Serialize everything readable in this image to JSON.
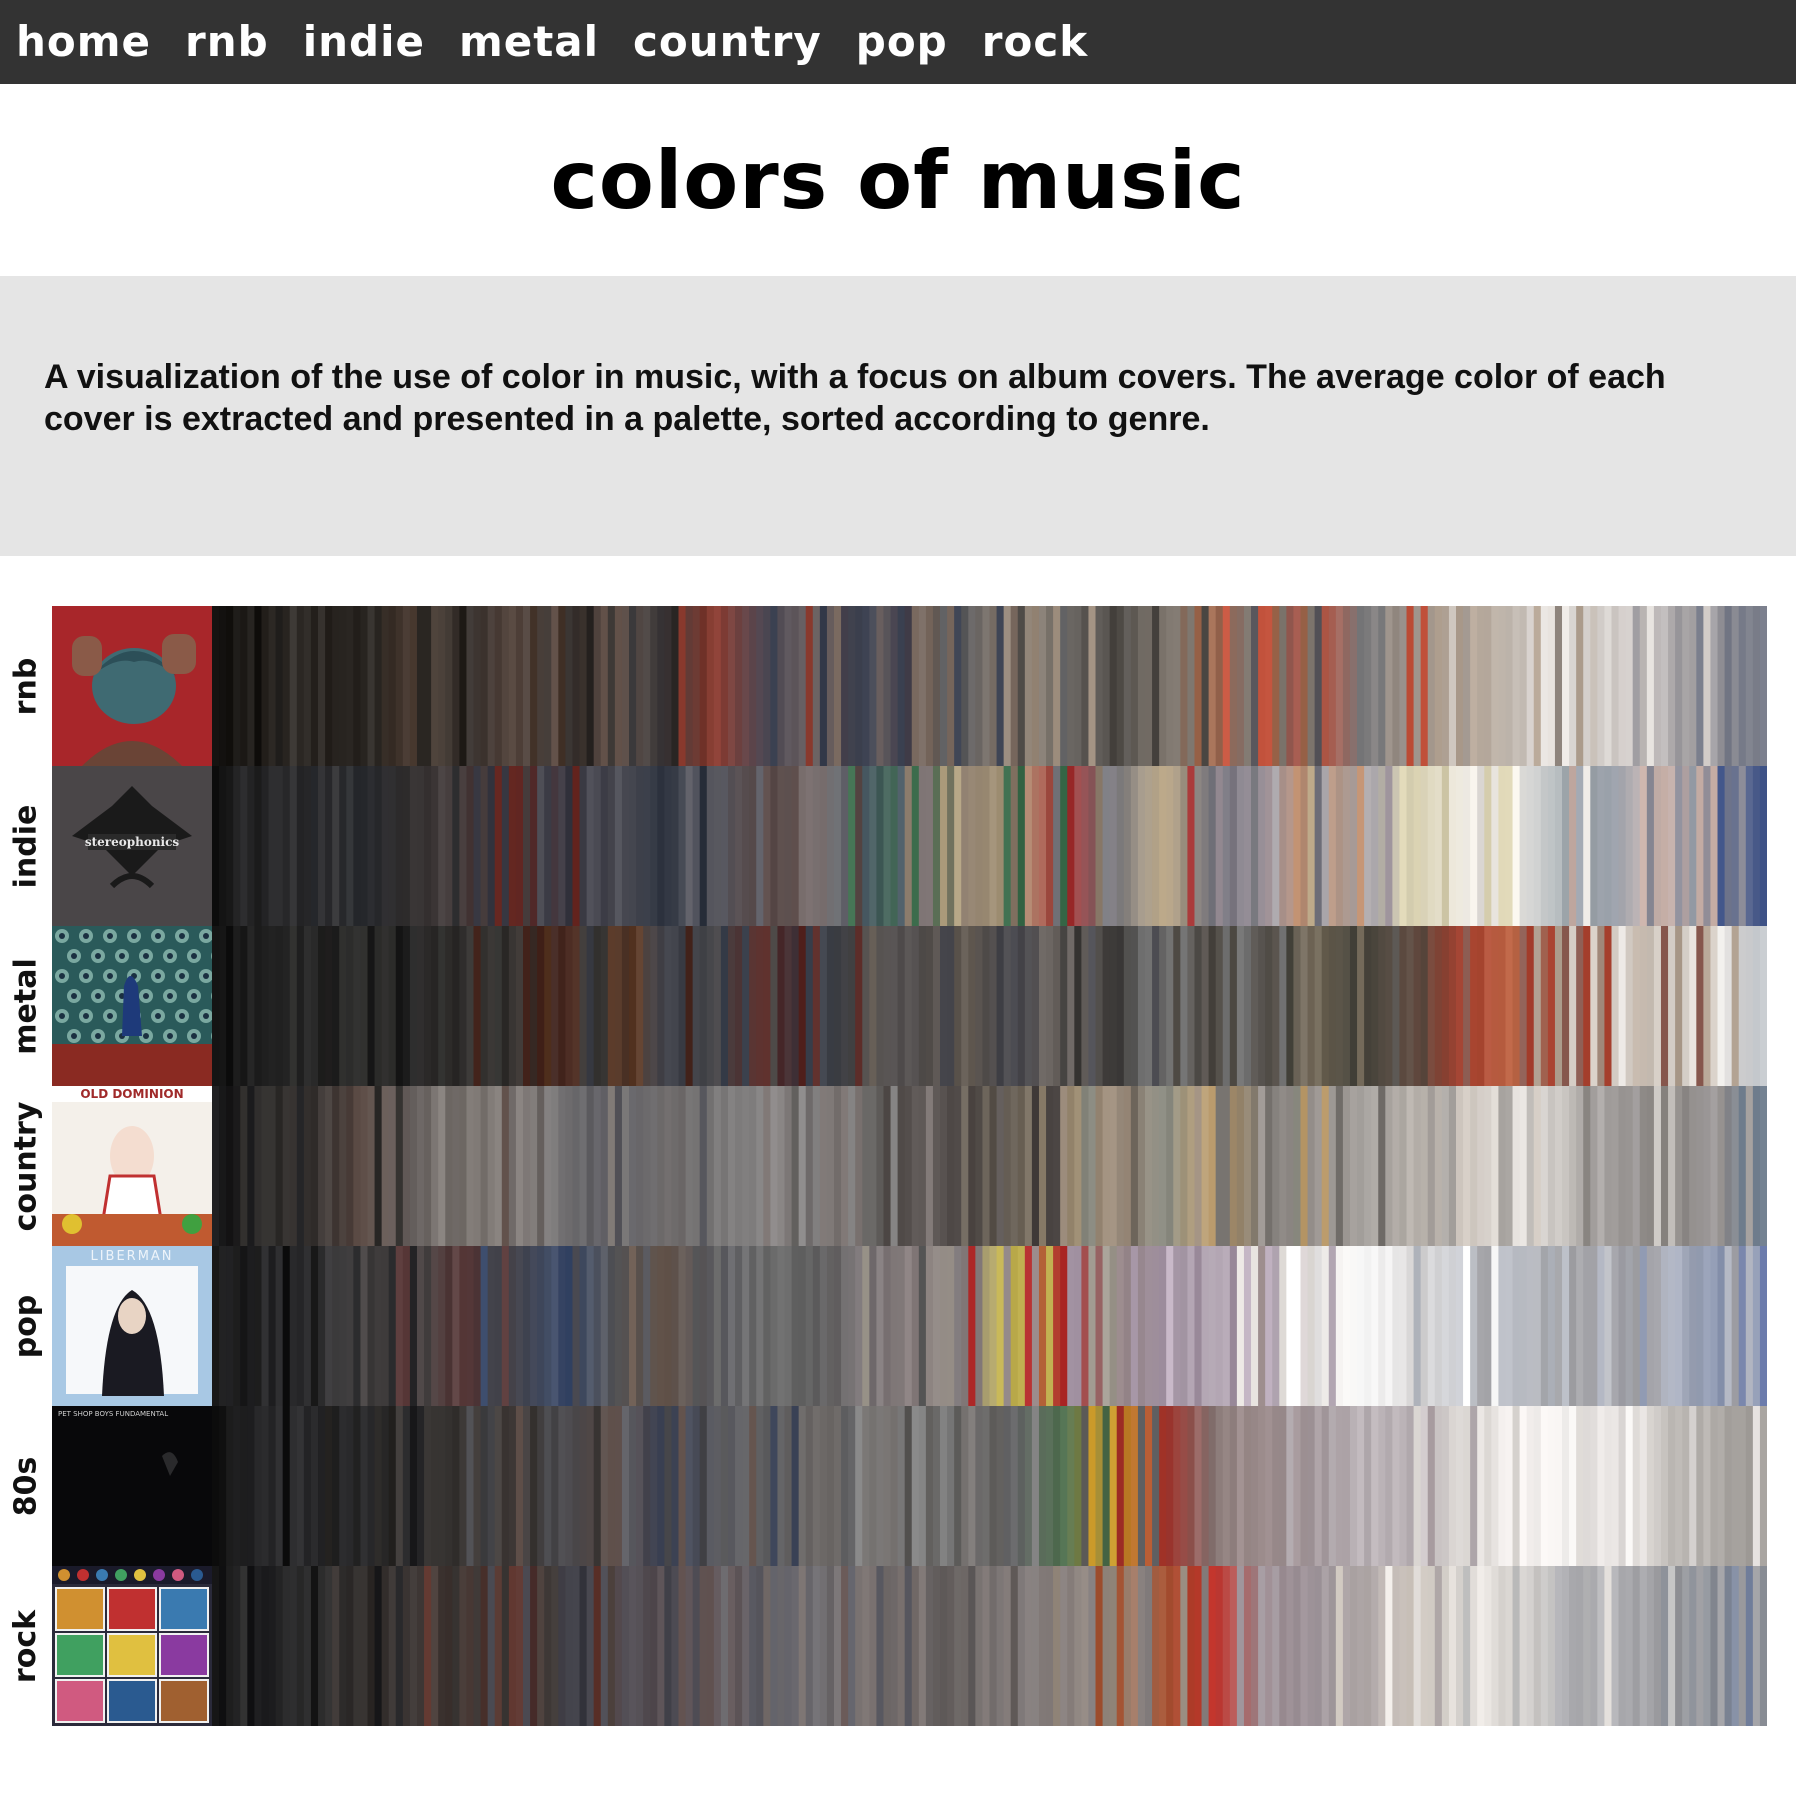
{
  "nav": {
    "items": [
      {
        "id": "home",
        "label": "home"
      },
      {
        "id": "rnb",
        "label": "rnb"
      },
      {
        "id": "indie",
        "label": "indie"
      },
      {
        "id": "metal",
        "label": "metal"
      },
      {
        "id": "country",
        "label": "country"
      },
      {
        "id": "pop",
        "label": "pop"
      },
      {
        "id": "rock",
        "label": "rock"
      }
    ]
  },
  "header": {
    "title": "colors of music"
  },
  "intro": {
    "text": "A visualization of the use of color in music, with a focus on album covers. The average color of each cover is extracted and presented in a palette, sorted according to genre."
  },
  "genres": [
    {
      "label": "rnb",
      "cover": {
        "kind": "rnb",
        "bg": "#a8262a",
        "accent": "#3f6a72",
        "skin": "#8a5a48"
      },
      "palette": [
        "#141210",
        "#2a2622",
        "#3a3632",
        "#24201c",
        "#4a3a30",
        "#3b3633",
        "#5a4a42",
        "#2e2a28",
        "#6b5a52",
        "#3c3a3c",
        "#8a3a2e",
        "#4a4652",
        "#6a6060",
        "#3a4050",
        "#7a6a60",
        "#5a5a5c",
        "#9a8a7a",
        "#6e6a66",
        "#4c4844",
        "#807870",
        "#a06a50",
        "#5c5a60",
        "#c0503a",
        "#7a7a7c",
        "#9a9088",
        "#b0a090",
        "#c8c0b8",
        "#e8e4e0",
        "#d6d0cc",
        "#b8b4b4",
        "#9c9a9e",
        "#707482"
      ]
    },
    {
      "label": "indie",
      "cover": {
        "kind": "indie",
        "bg": "#4a4648",
        "accent": "#1a1a1a",
        "text": "stereophonics"
      },
      "palette": [
        "#161616",
        "#262628",
        "#323234",
        "#2a2c30",
        "#3c3838",
        "#4a4040",
        "#6a2a24",
        "#3a3a44",
        "#505058",
        "#2e3440",
        "#606068",
        "#5a4a48",
        "#7a7070",
        "#4a5a64",
        "#3a6a4a",
        "#8a7a6a",
        "#b0a080",
        "#a03030",
        "#7a7a80",
        "#c4b090",
        "#6a6a74",
        "#9a9098",
        "#c09070",
        "#a4a0a4",
        "#d8d0b0",
        "#f0ece4",
        "#e4e0dc",
        "#a8b0b4",
        "#9aa0aa",
        "#c8b0a8",
        "#8a8a96",
        "#3e5286"
      ]
    },
    {
      "label": "metal",
      "cover": {
        "kind": "metal",
        "bg": "#2a5a5a",
        "accent": "#1e3a7a",
        "red": "#8a2a22"
      },
      "palette": [
        "#121212",
        "#1e1e1e",
        "#262626",
        "#2e2e2c",
        "#2a2828",
        "#343230",
        "#3a3634",
        "#4a2a22",
        "#5a3a28",
        "#3a3c44",
        "#444448",
        "#5a2a26",
        "#383e4a",
        "#4e4a48",
        "#5a5656",
        "#605850",
        "#4a4a50",
        "#6a6460",
        "#3c3a38",
        "#707070",
        "#4a4640",
        "#585450",
        "#7a7060",
        "#3a3830",
        "#5c4a40",
        "#a03a28",
        "#c06a4a",
        "#8a5a50",
        "#b0a090",
        "#d0c8c0",
        "#f0ece8",
        "#c0c4c8"
      ]
    },
    {
      "label": "country",
      "cover": {
        "kind": "country",
        "bg": "#f4f0ea",
        "accent": "#a02a2a",
        "text": "OLD DOMINION"
      },
      "palette": [
        "#1a1a1c",
        "#2a2826",
        "#3a3634",
        "#5a4a44",
        "#6a6462",
        "#7a7470",
        "#8a8480",
        "#706e70",
        "#5a5a60",
        "#6e6a6a",
        "#7c7a7a",
        "#8a8888",
        "#7a7270",
        "#6a6866",
        "#5a5452",
        "#4a4442",
        "#6a6258",
        "#9a8a70",
        "#a09080",
        "#8a8a80",
        "#c0a070",
        "#7a7672",
        "#9a9490",
        "#a8a4a0",
        "#b4aea8",
        "#d4ccc4",
        "#eae6e2",
        "#c4c0bc",
        "#a09c9a",
        "#8c8884",
        "#9a9696",
        "#6c7a8a"
      ]
    },
    {
      "label": "pop",
      "cover": {
        "kind": "pop",
        "bg": "#a8c8e4",
        "accent": "#1a1a22",
        "face": "#e8d4c4",
        "text": "LIBERMAN"
      },
      "palette": [
        "#161616",
        "#262628",
        "#323234",
        "#3e3c3c",
        "#4a4646",
        "#5a3a3a",
        "#4a4a52",
        "#3a4a6a",
        "#5a5a5c",
        "#6a5a50",
        "#606066",
        "#707070",
        "#5a5a5a",
        "#7a7476",
        "#8a8080",
        "#a09a90",
        "#c0b050",
        "#b02a2a",
        "#9a8a8a",
        "#a090a0",
        "#b4a8b4",
        "#c0b0c0",
        "#e4e0dc",
        "#ffffff",
        "#dad8d8",
        "#c8cad0",
        "#b4b8c0",
        "#a8a8ac",
        "#9c9ca2",
        "#b0b4c0",
        "#8e98b0",
        "#6070a0"
      ]
    },
    {
      "label": "80s",
      "cover": {
        "kind": "80s",
        "bg": "#08080a",
        "accent": "#2a2a2c",
        "text": "PET SHOP BOYS FUNDAMENTAL"
      },
      "palette": [
        "#161616",
        "#202022",
        "#2a2a2c",
        "#343436",
        "#2c2a28",
        "#3a3634",
        "#443e3c",
        "#4a4a4e",
        "#5a4a44",
        "#3c4458",
        "#5a5a60",
        "#646466",
        "#6e6a68",
        "#7a7674",
        "#808080",
        "#5c5a58",
        "#6a6a6c",
        "#4a6a4a",
        "#d0a030",
        "#a03028",
        "#8a7a78",
        "#9a8a8a",
        "#a89ca0",
        "#b8b0b4",
        "#c4bcc0",
        "#d8d4d0",
        "#eeeae8",
        "#f8f6f4",
        "#e0dcda",
        "#c8c4c0",
        "#b0aca8",
        "#a6a29e"
      ]
    },
    {
      "label": "rock",
      "cover": {
        "kind": "rock",
        "bg": "#2a2a3a",
        "accent": "#4a7aa0"
      },
      "palette": [
        "#141414",
        "#1e1e20",
        "#282828",
        "#322e2c",
        "#3a3432",
        "#463a36",
        "#5a3028",
        "#3e3e46",
        "#4a4850",
        "#5a5054",
        "#6a5a58",
        "#606068",
        "#6c6a6e",
        "#7a7270",
        "#5e5a5a",
        "#6a6462",
        "#7e7878",
        "#8a8280",
        "#9a8e82",
        "#a05030",
        "#c03028",
        "#9a8a90",
        "#a49aa0",
        "#b0a8a8",
        "#c8c0b8",
        "#ece8e4",
        "#d8d4d0",
        "#c4c4c4",
        "#b0b0b4",
        "#9c9ca0",
        "#8c9098",
        "#6a7aa0"
      ]
    }
  ]
}
